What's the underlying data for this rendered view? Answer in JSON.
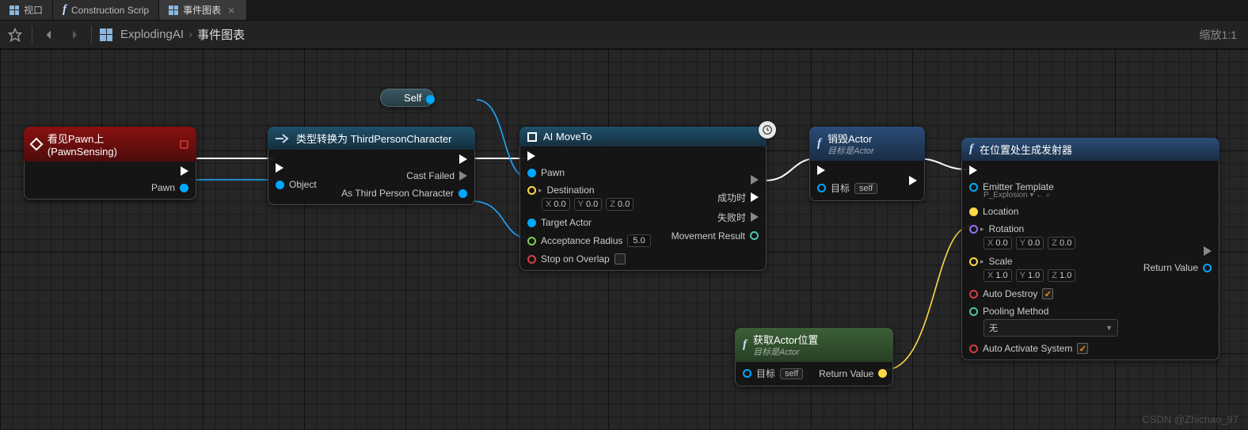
{
  "tabs": [
    {
      "label": "视口",
      "active": false
    },
    {
      "label": "Construction Scrip",
      "active": false,
      "icon": "fn"
    },
    {
      "label": "事件图表",
      "active": true,
      "closable": true
    }
  ],
  "breadcrumb": {
    "root": "ExplodingAI",
    "leaf": "事件图表"
  },
  "zoom": "缩放1:1",
  "watermark": "CSDN @Zhichao_97",
  "self_pill": {
    "label": "Self"
  },
  "nodes": {
    "event": {
      "title": "看见Pawn上 (PawnSensing)",
      "out_pawn": "Pawn"
    },
    "cast": {
      "title": "类型转换为 ThirdPersonCharacter",
      "in_object": "Object",
      "out_failed": "Cast Failed",
      "out_as": "As Third Person Character"
    },
    "aimove": {
      "title": "AI MoveTo",
      "in_pawn": "Pawn",
      "in_dest": "Destination",
      "dest_x": "0.0",
      "dest_y": "0.0",
      "dest_z": "0.0",
      "in_target": "Target Actor",
      "in_radius": "Acceptance Radius",
      "radius_val": "5.0",
      "in_stop": "Stop on Overlap",
      "out_success": "成功时",
      "out_fail": "失败时",
      "out_result": "Movement Result"
    },
    "destroy": {
      "title": "销毁Actor",
      "sub": "目标是Actor",
      "in_target": "目标",
      "self": "self"
    },
    "getloc": {
      "title": "获取Actor位置",
      "sub": "目标是Actor",
      "in_target": "目标",
      "self": "self",
      "out_ret": "Return Value"
    },
    "spawn": {
      "title": "在位置处生成发射器",
      "in_template": "Emitter Template",
      "template_val": "P_Explosion",
      "in_location": "Location",
      "in_rotation": "Rotation",
      "rot_x": "0.0",
      "rot_y": "0.0",
      "rot_z": "0.0",
      "in_scale": "Scale",
      "scl_x": "1.0",
      "scl_y": "1.0",
      "scl_z": "1.0",
      "in_autodestroy": "Auto Destroy",
      "in_pooling": "Pooling Method",
      "pooling_val": "无",
      "in_autoactivate": "Auto Activate System",
      "out_ret": "Return Value"
    }
  },
  "vec_labels": {
    "x": "X",
    "y": "Y",
    "z": "Z"
  }
}
